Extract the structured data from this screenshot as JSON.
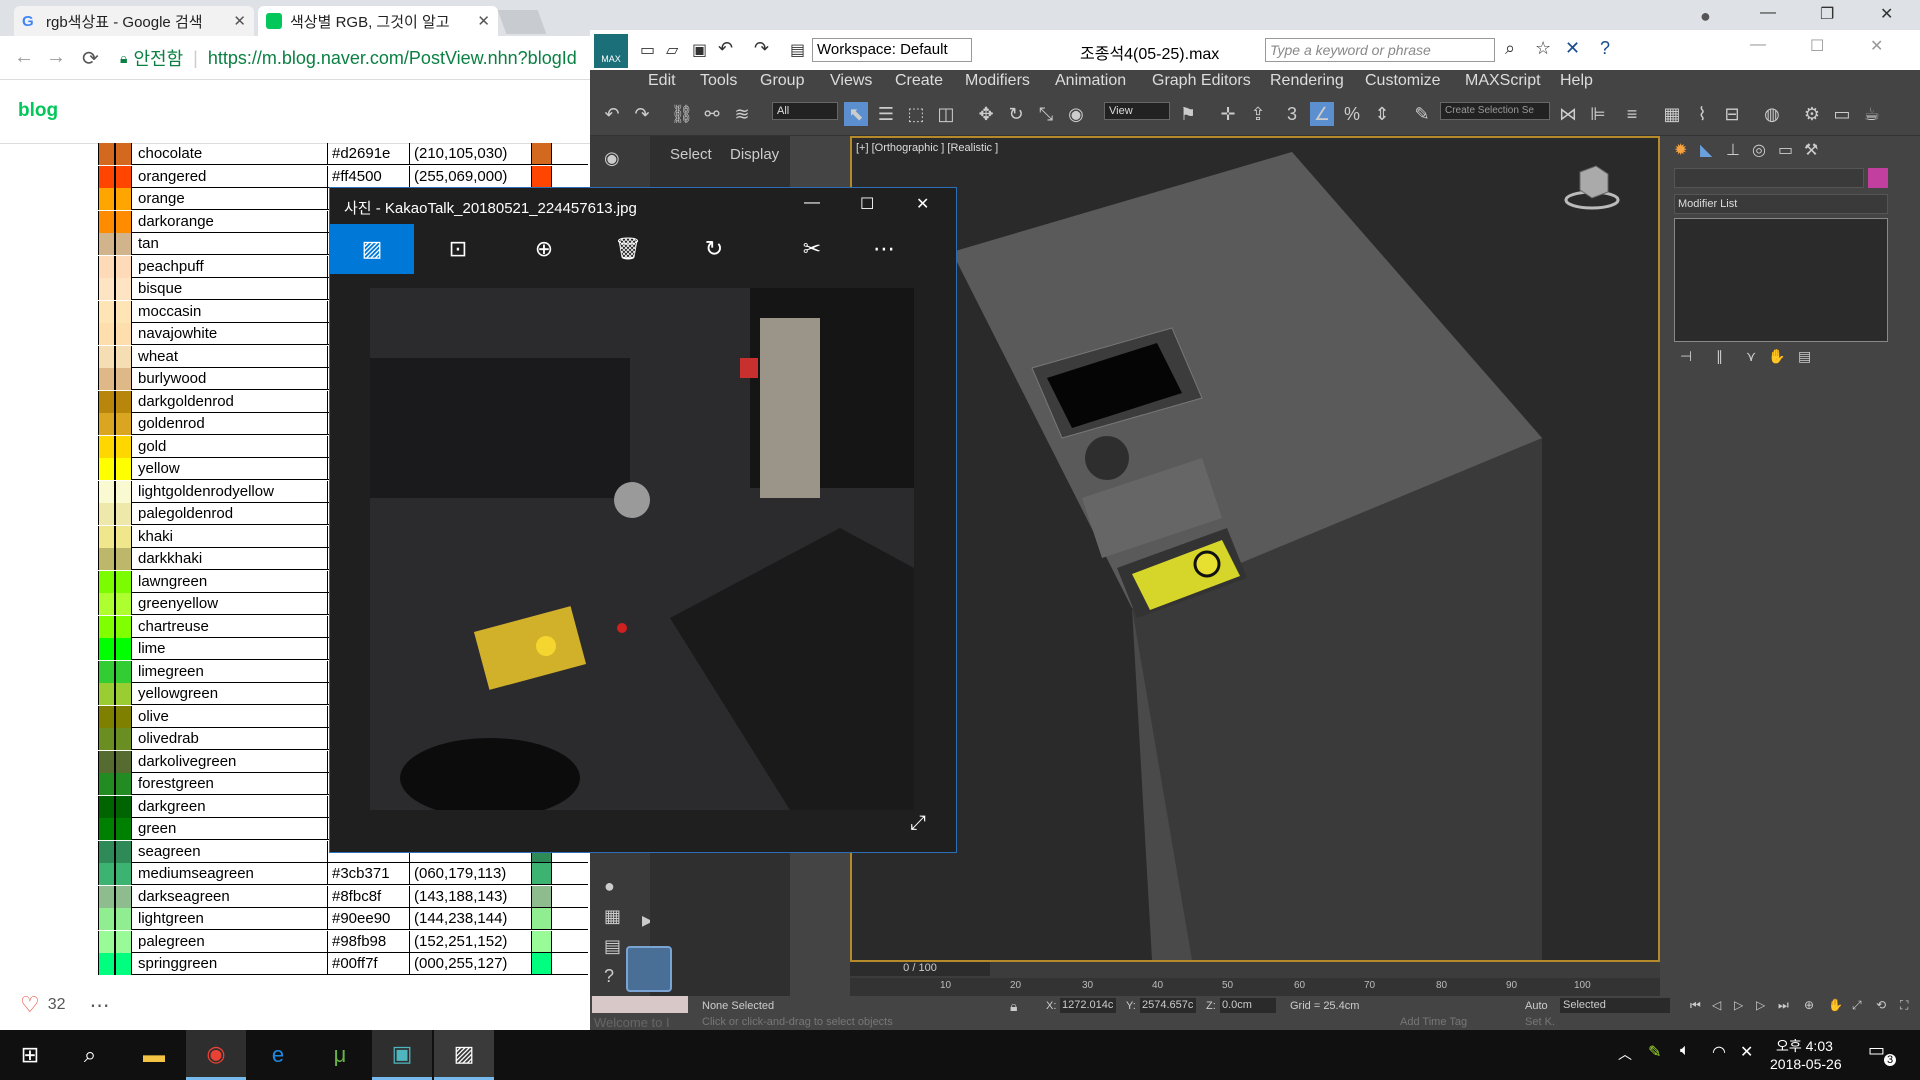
{
  "chrome": {
    "tabs": [
      {
        "title": "rgb색상표 - Google 검색"
      },
      {
        "title": "색상별 RGB, 그것이 알고"
      }
    ],
    "secure_label": "안전함",
    "url": "https://m.blog.naver.com/PostView.nhn?blogId",
    "blog_logo": "blog",
    "likes": "32"
  },
  "color_table": [
    {
      "name": "chocolate",
      "hex": "#d2691e",
      "rgb": "(210,105,030)",
      "c": "#d2691e"
    },
    {
      "name": "orangered",
      "hex": "#ff4500",
      "rgb": "(255,069,000)",
      "c": "#ff4500"
    },
    {
      "name": "orange",
      "hex": "",
      "rgb": "",
      "c": "#ffa500"
    },
    {
      "name": "darkorange",
      "hex": "",
      "rgb": "",
      "c": "#ff8c00"
    },
    {
      "name": "tan",
      "hex": "",
      "rgb": "",
      "c": "#d2b48c"
    },
    {
      "name": "peachpuff",
      "hex": "",
      "rgb": "",
      "c": "#ffdab9"
    },
    {
      "name": "bisque",
      "hex": "",
      "rgb": "",
      "c": "#ffe4c4"
    },
    {
      "name": "moccasin",
      "hex": "",
      "rgb": "",
      "c": "#ffe4b5"
    },
    {
      "name": "navajowhite",
      "hex": "",
      "rgb": "",
      "c": "#ffdead"
    },
    {
      "name": "wheat",
      "hex": "",
      "rgb": "",
      "c": "#f5deb3"
    },
    {
      "name": "burlywood",
      "hex": "",
      "rgb": "",
      "c": "#deb887"
    },
    {
      "name": "darkgoldenrod",
      "hex": "",
      "rgb": "",
      "c": "#b8860b"
    },
    {
      "name": "goldenrod",
      "hex": "",
      "rgb": "",
      "c": "#daa520"
    },
    {
      "name": "gold",
      "hex": "",
      "rgb": "",
      "c": "#ffd700"
    },
    {
      "name": "yellow",
      "hex": "",
      "rgb": "",
      "c": "#ffff00"
    },
    {
      "name": "lightgoldenrodyellow",
      "hex": "",
      "rgb": "",
      "c": "#fafad2"
    },
    {
      "name": "palegoldenrod",
      "hex": "",
      "rgb": "",
      "c": "#eee8aa"
    },
    {
      "name": "khaki",
      "hex": "",
      "rgb": "",
      "c": "#f0e68c"
    },
    {
      "name": "darkkhaki",
      "hex": "",
      "rgb": "",
      "c": "#bdb76b"
    },
    {
      "name": "lawngreen",
      "hex": "",
      "rgb": "",
      "c": "#7cfc00"
    },
    {
      "name": "greenyellow",
      "hex": "",
      "rgb": "",
      "c": "#adff2f"
    },
    {
      "name": "chartreuse",
      "hex": "",
      "rgb": "",
      "c": "#7fff00"
    },
    {
      "name": "lime",
      "hex": "",
      "rgb": "",
      "c": "#00ff00"
    },
    {
      "name": "limegreen",
      "hex": "",
      "rgb": "",
      "c": "#32cd32"
    },
    {
      "name": "yellowgreen",
      "hex": "",
      "rgb": "",
      "c": "#9acd32"
    },
    {
      "name": "olive",
      "hex": "",
      "rgb": "",
      "c": "#808000"
    },
    {
      "name": "olivedrab",
      "hex": "",
      "rgb": "",
      "c": "#6b8e23"
    },
    {
      "name": "darkolivegreen",
      "hex": "",
      "rgb": "",
      "c": "#556b2f"
    },
    {
      "name": "forestgreen",
      "hex": "",
      "rgb": "",
      "c": "#228b22"
    },
    {
      "name": "darkgreen",
      "hex": "",
      "rgb": "",
      "c": "#006400"
    },
    {
      "name": "green",
      "hex": "",
      "rgb": "",
      "c": "#008000"
    },
    {
      "name": "seagreen",
      "hex": "",
      "rgb": "",
      "c": "#2e8b57"
    },
    {
      "name": "mediumseagreen",
      "hex": "#3cb371",
      "rgb": "(060,179,113)",
      "c": "#3cb371"
    },
    {
      "name": "darkseagreen",
      "hex": "#8fbc8f",
      "rgb": "(143,188,143)",
      "c": "#8fbc8f"
    },
    {
      "name": "lightgreen",
      "hex": "#90ee90",
      "rgb": "(144,238,144)",
      "c": "#90ee90"
    },
    {
      "name": "palegreen",
      "hex": "#98fb98",
      "rgb": "(152,251,152)",
      "c": "#98fb98"
    },
    {
      "name": "springgreen",
      "hex": "#00ff7f",
      "rgb": "(000,255,127)",
      "c": "#00ff7f"
    }
  ],
  "max": {
    "workspace": "Workspace: Default",
    "file": "조종석4(05-25).max",
    "search_placeholder": "Type a keyword or phrase",
    "menu": [
      "Edit",
      "Tools",
      "Group",
      "Views",
      "Create",
      "Modifiers",
      "Animation",
      "Graph Editors",
      "Rendering",
      "Customize",
      "MAXScript",
      "Help"
    ],
    "scene_tabs": [
      "Select",
      "Display"
    ],
    "filter": "All",
    "view": "View",
    "selset": "Create Selection Se",
    "viewport_label": "[+] [Orthographic ] [Realistic ]",
    "modifier_list": "Modifier List",
    "timeline": "0 / 100",
    "ticks": [
      "10",
      "20",
      "30",
      "40",
      "50",
      "60",
      "70",
      "80",
      "90",
      "100"
    ],
    "status": "None Selected",
    "hint": "Click or click-and-drag to select objects",
    "welcome": "Welcome to I",
    "x": "1272.014c",
    "y": "2574.657c",
    "z": "0.0cm",
    "grid": "Grid = 25.4cm",
    "auto": "Auto",
    "selected": "Selected",
    "addtag": "Add Time Tag",
    "setk": "Set K."
  },
  "photos": {
    "title": "사진 - KakaoTalk_20180521_224457613.jpg"
  },
  "taskbar": {
    "time": "오후 4:03",
    "date": "2018-05-26",
    "notif": "3"
  }
}
